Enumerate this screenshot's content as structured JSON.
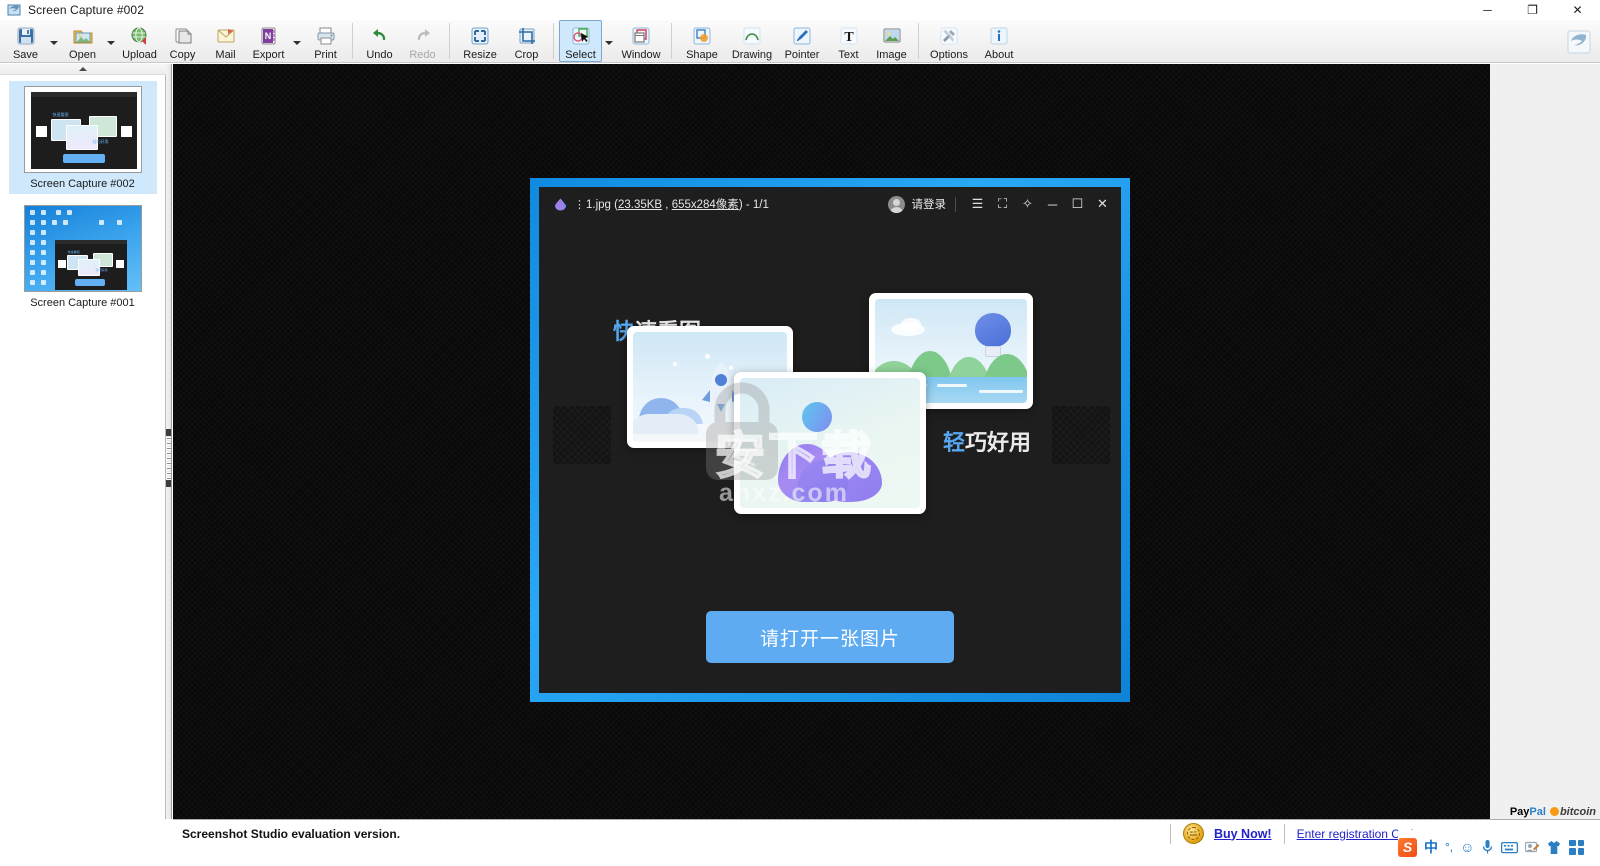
{
  "window": {
    "title": "Screen Capture #002",
    "app_icon": "screen-capture-logo-icon",
    "controls": {
      "minimize": "─",
      "maximize": "❐",
      "close": "✕"
    }
  },
  "toolbar": {
    "groups": [
      {
        "items": [
          {
            "label": "Save",
            "icon": "floppy-disk-icon",
            "dropdown": true,
            "state": "normal"
          },
          {
            "label": "Open",
            "icon": "open-folder-icon",
            "dropdown": true,
            "state": "normal"
          },
          {
            "label": "Upload",
            "icon": "upload-globe-icon",
            "dropdown": false,
            "state": "normal"
          },
          {
            "label": "Copy",
            "icon": "copy-icon",
            "dropdown": false,
            "state": "normal"
          },
          {
            "label": "Mail",
            "icon": "mail-icon",
            "dropdown": false,
            "state": "normal"
          },
          {
            "label": "Export",
            "icon": "export-onenote-icon",
            "dropdown": true,
            "state": "normal"
          },
          {
            "label": "Print",
            "icon": "printer-icon",
            "dropdown": false,
            "state": "normal"
          }
        ]
      },
      {
        "items": [
          {
            "label": "Undo",
            "icon": "undo-arrow-icon",
            "dropdown": false,
            "state": "normal"
          },
          {
            "label": "Redo",
            "icon": "redo-arrow-icon",
            "dropdown": false,
            "state": "disabled"
          }
        ]
      },
      {
        "items": [
          {
            "label": "Resize",
            "icon": "resize-arrows-icon",
            "dropdown": false,
            "state": "normal"
          },
          {
            "label": "Crop",
            "icon": "crop-icon",
            "dropdown": false,
            "state": "normal"
          }
        ]
      },
      {
        "items": [
          {
            "label": "Select",
            "icon": "select-cursor-icon",
            "dropdown": true,
            "state": "active"
          },
          {
            "label": "Window",
            "icon": "window-icon",
            "dropdown": false,
            "state": "normal"
          }
        ]
      },
      {
        "items": [
          {
            "label": "Shape",
            "icon": "shapes-icon",
            "dropdown": false,
            "state": "normal"
          },
          {
            "label": "Drawing",
            "icon": "curve-icon",
            "dropdown": false,
            "state": "normal"
          },
          {
            "label": "Pointer",
            "icon": "pen-icon",
            "dropdown": false,
            "state": "normal"
          },
          {
            "label": "Text",
            "icon": "text-t-icon",
            "dropdown": false,
            "state": "normal"
          },
          {
            "label": "Image",
            "icon": "picture-icon",
            "dropdown": false,
            "state": "normal"
          }
        ]
      },
      {
        "items": [
          {
            "label": "Options",
            "icon": "tools-icon",
            "dropdown": false,
            "state": "normal"
          },
          {
            "label": "About",
            "icon": "info-i-icon",
            "dropdown": false,
            "state": "normal"
          }
        ]
      }
    ],
    "brand_icon": "screenshot-studio-s-logo-icon"
  },
  "thumbnails": {
    "scroll_up_icon": "triangle-up-icon",
    "items": [
      {
        "caption": "Screen Capture #002",
        "selected": true,
        "kind": "viewer-window"
      },
      {
        "caption": "Screen Capture #001",
        "selected": false,
        "kind": "desktop"
      }
    ]
  },
  "viewer": {
    "title_prefix": "1.jpg (",
    "file_size": "23.35KB",
    "title_mid": " , ",
    "dimensions": "655x284像素",
    "title_suffix": ") - 1/1",
    "menu_dots": "⋮",
    "app_icon": "image-viewer-app-icon",
    "login_label": "请登录",
    "avatar": "user-avatar-icon",
    "controls": {
      "menu": "☰",
      "fullscreen": "⛶",
      "pin": "✧",
      "minimize": "─",
      "maximize": "☐",
      "close": "✕"
    },
    "hero_left": {
      "accent": "快",
      "rest": "速看图"
    },
    "hero_right": {
      "accent": "轻",
      "rest": "巧好用"
    },
    "open_button": "请打开一张图片",
    "watermark": {
      "lock_icon": "lock-watermark-icon",
      "cn_text": "安下载",
      "url_text": "anxz.com"
    },
    "accent_color": "#55a8f0",
    "button_color": "#5fabf2",
    "frame_color": "#1d9bf0"
  },
  "statusbar": {
    "message": "Screenshot Studio evaluation version.",
    "seal_icon": "gold-seal-icon",
    "seal_text": "BUY NOW",
    "buy_now": "Buy Now!",
    "enter_code": "Enter registration Code...",
    "paypal": {
      "part1": "Pay",
      "part2": "Pal"
    },
    "bitcoin": "bitcoin",
    "bitcoin_icon": "bitcoin-coin-icon"
  },
  "tray": {
    "items": [
      {
        "icon": "sogou-ime-icon",
        "label": "S"
      },
      {
        "icon": "chinese-mode-icon",
        "label": "中"
      },
      {
        "icon": "punctuation-icon",
        "label": "°,"
      },
      {
        "icon": "emoji-icon",
        "label": "☺"
      },
      {
        "icon": "microphone-icon",
        "label": "🎙"
      },
      {
        "icon": "keyboard-icon",
        "label": "⌨"
      },
      {
        "icon": "handwriting-icon",
        "label": "✎"
      },
      {
        "icon": "skin-shirt-icon",
        "label": "👕"
      },
      {
        "icon": "toolbox-grid-icon",
        "label": ""
      }
    ]
  }
}
